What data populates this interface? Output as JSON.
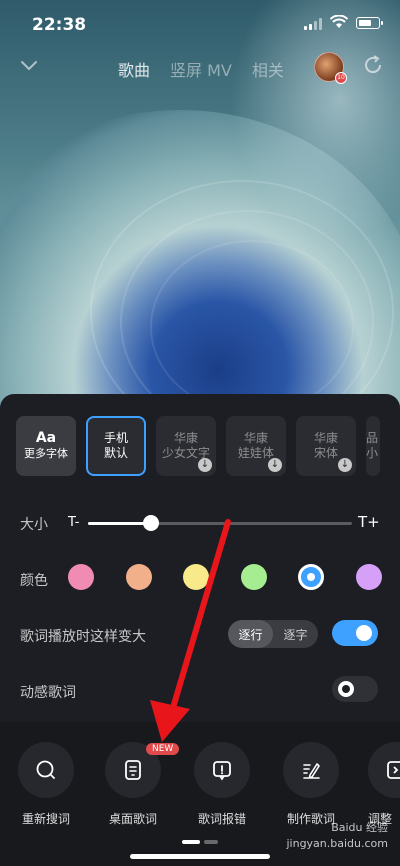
{
  "status": {
    "time": "22:38"
  },
  "header": {
    "tabs": [
      "歌曲",
      "竖屏 MV",
      "相关"
    ],
    "active_tab": "歌曲",
    "avatar_badge": "10"
  },
  "fonts": [
    {
      "label": "更多字体",
      "icon": "Aa"
    },
    {
      "label": "手机\n默认",
      "selected": true
    },
    {
      "label": "华康\n少女文字",
      "download": true
    },
    {
      "label": "华康\n娃娃体",
      "download": true
    },
    {
      "label": "华康\n宋体",
      "download": true
    },
    {
      "label": "品\n小",
      "download": false
    }
  ],
  "size": {
    "label": "大小",
    "min_label": "T-",
    "max_label": "T+",
    "value": 0.24
  },
  "color": {
    "label": "颜色",
    "swatches": [
      "#f08cb4",
      "#f2b08a",
      "#f8e98a",
      "#a6ec90",
      "#3ea0ff",
      "#d6a0f8"
    ],
    "selected_index": 4
  },
  "grow": {
    "label": "歌词播放时这样变大",
    "options": [
      "逐行",
      "逐字"
    ],
    "selected": "逐行",
    "enabled": true
  },
  "dynamic": {
    "label": "动感歌词",
    "enabled": false
  },
  "actions": [
    {
      "label": "重新搜词",
      "icon": "search-icon"
    },
    {
      "label": "桌面歌词",
      "icon": "desktop-lyrics-icon",
      "badge": "NEW"
    },
    {
      "label": "歌词报错",
      "icon": "report-icon"
    },
    {
      "label": "制作歌词",
      "icon": "edit-icon"
    },
    {
      "label": "调整",
      "icon": "adjust-icon"
    }
  ],
  "watermark": {
    "line1": "Baidu 经验",
    "line2": "jingyan.baidu.com"
  },
  "accent": "#3ea0ff"
}
